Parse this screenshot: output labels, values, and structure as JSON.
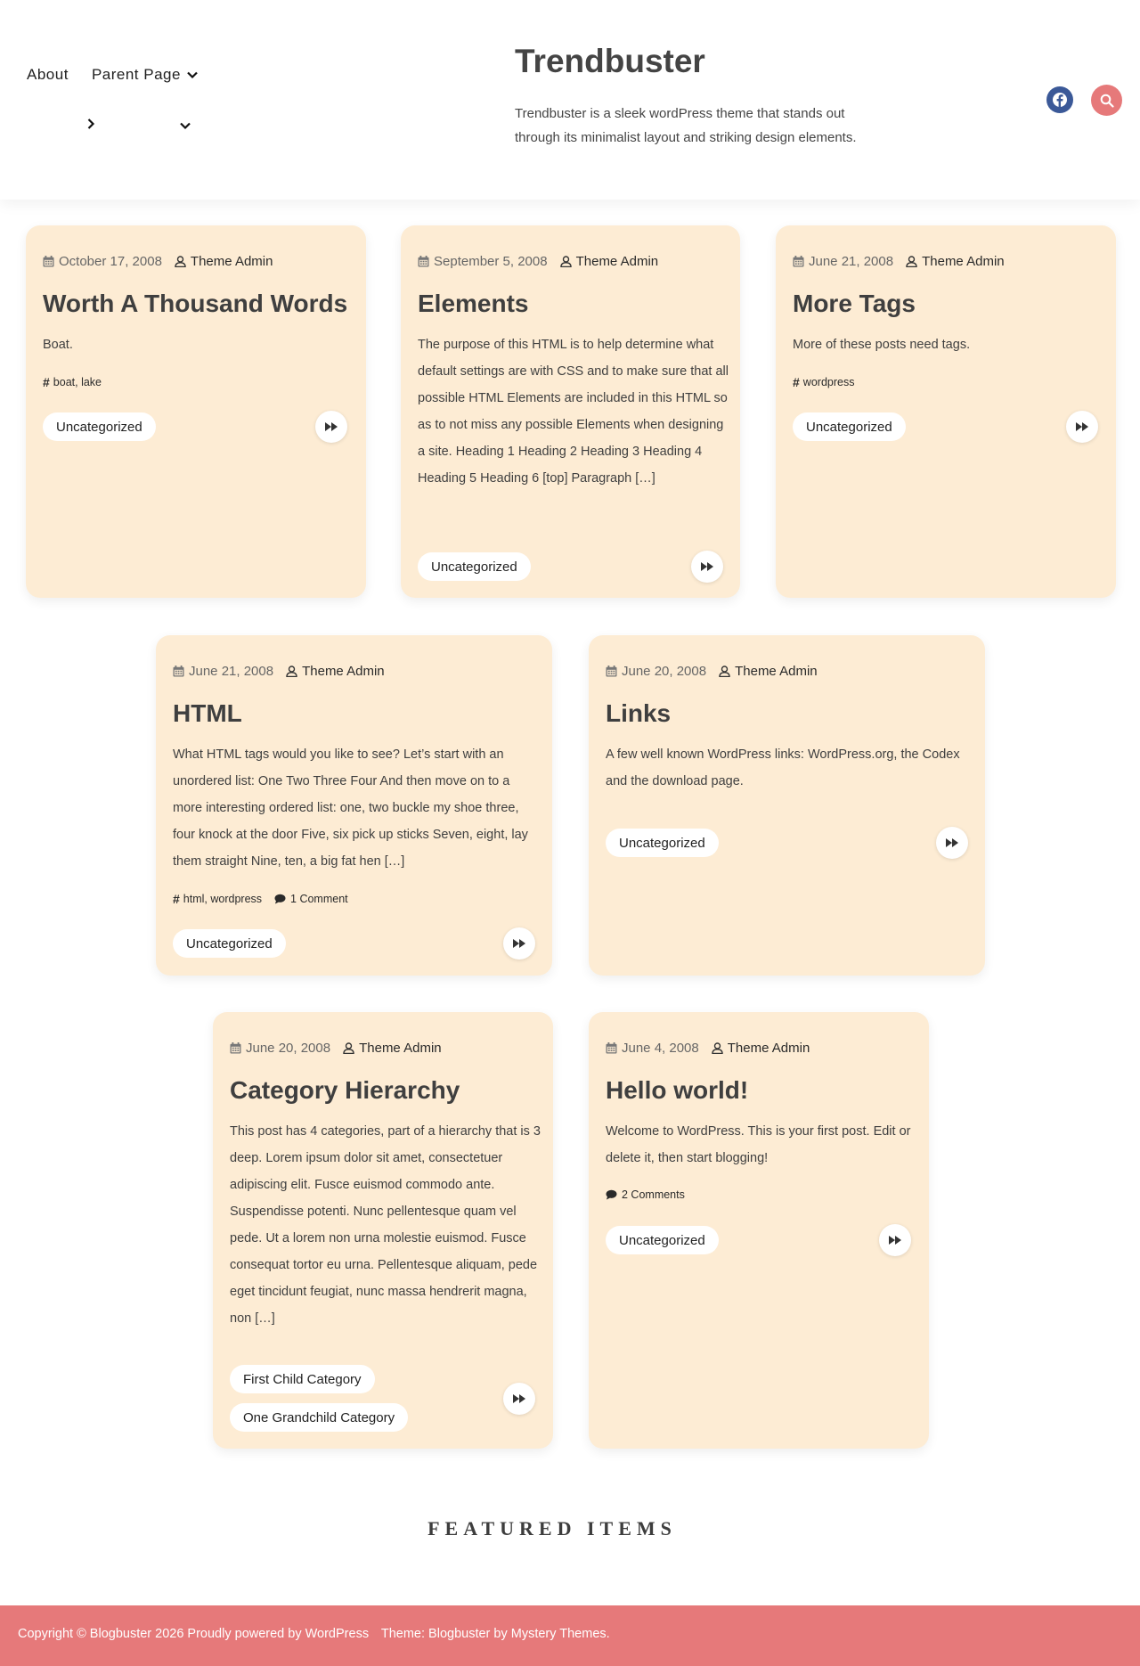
{
  "nav": {
    "items": [
      {
        "label": "About"
      },
      {
        "label": "Parent Page"
      }
    ]
  },
  "site": {
    "title": "Trendbuster",
    "description": "Trendbuster is a sleek wordPress theme that stands out through its minimalist layout and striking design elements."
  },
  "header_icons": {
    "social": "facebook-icon",
    "search": "search-icon"
  },
  "posts": [
    {
      "date": "October 17, 2008",
      "author": "Theme Admin",
      "title": "Worth A Thousand Words",
      "excerpt": "Boat.",
      "tags": "boat, lake",
      "categories": [
        "Uncategorized"
      ]
    },
    {
      "date": "September 5, 2008",
      "author": "Theme Admin",
      "title": "Elements",
      "excerpt": "The purpose of this HTML is to help determine what default settings are with CSS and to make sure that all possible HTML Elements are included in this HTML so as to not miss any possible Elements when designing a site. Heading 1 Heading 2 Heading 3 Heading 4 Heading 5 Heading 6 [top] Paragraph […]",
      "categories": [
        "Uncategorized"
      ]
    },
    {
      "date": "June 21, 2008",
      "author": "Theme Admin",
      "title": "More Tags",
      "excerpt": "More of these posts need tags.",
      "tags": "wordpress",
      "categories": [
        "Uncategorized"
      ]
    },
    {
      "date": "June 21, 2008",
      "author": "Theme Admin",
      "title": "HTML",
      "excerpt": "What HTML tags would you like to see? Let’s start with an unordered list: One Two Three Four And then move on to a more interesting ordered list: one, two buckle my shoe three, four knock at the door Five, six pick up sticks Seven, eight, lay them straight Nine, ten, a big fat hen […]",
      "tags": "html, wordpress",
      "comments": "1 Comment",
      "categories": [
        "Uncategorized"
      ]
    },
    {
      "date": "June 20, 2008",
      "author": "Theme Admin",
      "title": "Links",
      "excerpt": "A few well known WordPress links: WordPress.org, the Codex and the download page.",
      "categories": [
        "Uncategorized"
      ]
    },
    {
      "date": "June 20, 2008",
      "author": "Theme Admin",
      "title": "Category Hierarchy",
      "excerpt": "This post has 4 categories, part of a hierarchy that is 3 deep. Lorem ipsum dolor sit amet, consectetuer adipiscing elit. Fusce euismod commodo ante. Suspendisse potenti. Nunc pellentesque quam vel pede. Ut a lorem non urna molestie euismod. Fusce consequat tortor eu urna. Pellentesque aliquam, pede eget tincidunt feugiat, nunc massa hendrerit magna, non […]",
      "categories": [
        "First Child Category",
        "One Grandchild Category"
      ]
    },
    {
      "date": "June 4, 2008",
      "author": "Theme Admin",
      "title": "Hello world!",
      "excerpt": "Welcome to WordPress. This is your first post. Edit or delete it, then start blogging!",
      "comments": "2 Comments",
      "categories": [
        "Uncategorized"
      ]
    }
  ],
  "featured": {
    "heading": "FEATURED ITEMS"
  },
  "footer": {
    "copyright": "Copyright © Blogbuster 2026 Proudly powered by WordPress",
    "theme": "Theme: Blogbuster by Mystery Themes."
  },
  "colors": {
    "card_bg": "#fdecd4",
    "accent": "#e6797a",
    "facebook": "#3b5998"
  }
}
